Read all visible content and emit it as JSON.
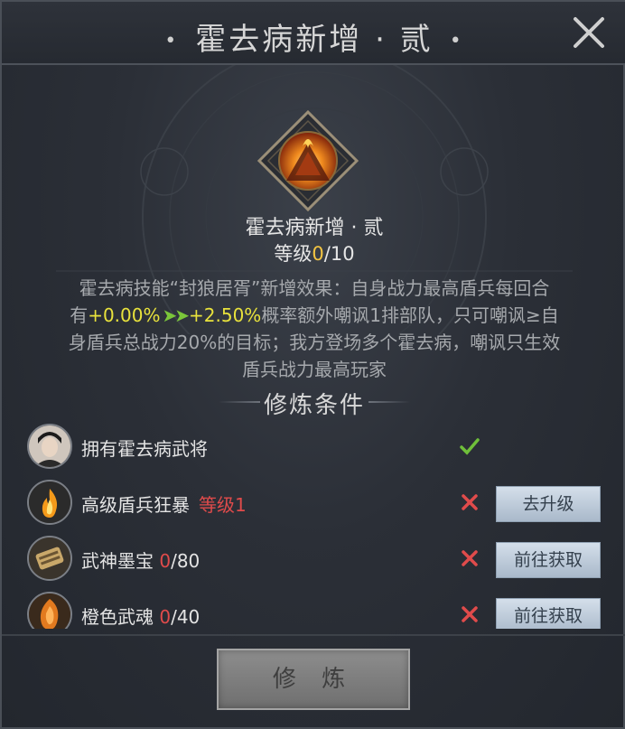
{
  "header": {
    "title": "霍去病新增 · 贰"
  },
  "skill": {
    "name": "霍去病新增 · 贰",
    "level_prefix": "等级",
    "level_current": "0",
    "level_max": "/10"
  },
  "description": {
    "line1": "霍去病技能“封狼居胥”新增效果：自身战力最高盾兵每回合",
    "line2_prefix": "有",
    "value_from": "+0.00%",
    "value_to": "+2.50%",
    "line2_suffix": "概率额外嘲讽1排部队，只可嘲讽≥自",
    "line3": "身盾兵总战力20%的目标；我方登场多个霍去病，嘲讽只生效",
    "line4": "盾兵战力最高玩家"
  },
  "section": {
    "title": "修炼条件"
  },
  "conditions": [
    {
      "label": "拥有霍去病武将",
      "status": "met",
      "icon": "general-portrait"
    },
    {
      "label": "高级盾兵狂暴",
      "extra": "等级1",
      "status": "unmet",
      "button": "去升级",
      "icon": "fire-skill-icon"
    },
    {
      "label": "武神墨宝",
      "have": "0",
      "need": "/80",
      "status": "unmet",
      "button": "前往获取",
      "icon": "scroll-item-icon"
    },
    {
      "label": "橙色武魂",
      "have": "0",
      "need": "/40",
      "status": "unmet",
      "button": "前往获取",
      "icon": "orange-soul-icon"
    }
  ],
  "footer": {
    "button": "修 炼"
  },
  "colors": {
    "gold": "#f4c542",
    "red": "#e04b4b",
    "green": "#7bc63a",
    "value": "#e8e23c"
  }
}
